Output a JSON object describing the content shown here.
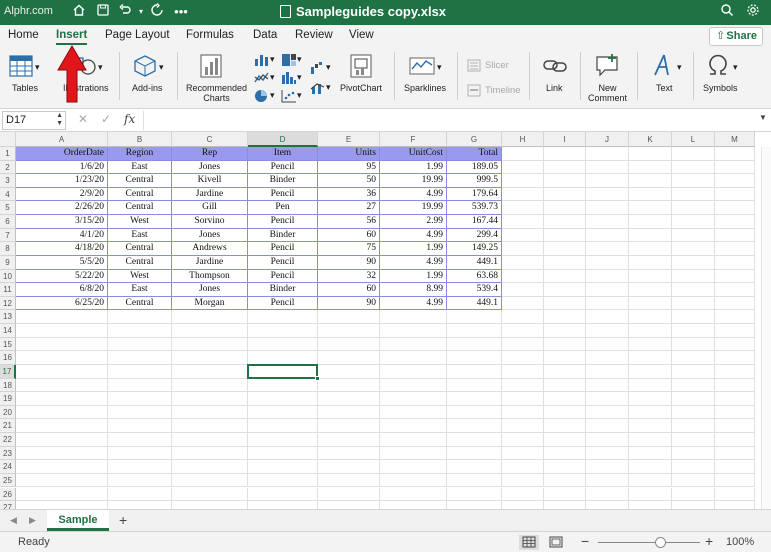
{
  "watermark": "Alphr.com",
  "window": {
    "title": "Sampleguides copy.xlsx"
  },
  "tabs": [
    {
      "label": "Home",
      "active": false
    },
    {
      "label": "Insert",
      "active": true
    },
    {
      "label": "Page Layout",
      "active": false
    },
    {
      "label": "Formulas",
      "active": false
    },
    {
      "label": "Data",
      "active": false
    },
    {
      "label": "Review",
      "active": false
    },
    {
      "label": "View",
      "active": false
    }
  ],
  "share_label": "Share",
  "ribbon": {
    "tables": "Tables",
    "illustrations": "Illustrations",
    "addins": "Add-ins",
    "recommended_charts_1": "Recommended",
    "recommended_charts_2": "Charts",
    "pivotchart": "PivotChart",
    "sparklines": "Sparklines",
    "slicer": "Slicer",
    "timeline": "Timeline",
    "link": "Link",
    "new_comment_1": "New",
    "new_comment_2": "Comment",
    "text": "Text",
    "symbols": "Symbols"
  },
  "formula_bar": {
    "name_box": "D17",
    "fx": "fx",
    "value": ""
  },
  "columns": [
    "A",
    "B",
    "C",
    "D",
    "E",
    "F",
    "G",
    "H",
    "I",
    "J",
    "K",
    "L",
    "M"
  ],
  "selected_cell": {
    "column": "D",
    "row": 17
  },
  "table": {
    "headers": [
      "OrderDate",
      "Region",
      "Rep",
      "Item",
      "Units",
      "UnitCost",
      "Total"
    ],
    "rows": [
      [
        "1/6/20",
        "East",
        "Jones",
        "Pencil",
        "95",
        "1.99",
        "189.05"
      ],
      [
        "1/23/20",
        "Central",
        "Kivell",
        "Binder",
        "50",
        "19.99",
        "999.5"
      ],
      [
        "2/9/20",
        "Central",
        "Jardine",
        "Pencil",
        "36",
        "4.99",
        "179.64"
      ],
      [
        "2/26/20",
        "Central",
        "Gill",
        "Pen",
        "27",
        "19.99",
        "539.73"
      ],
      [
        "3/15/20",
        "West",
        "Sorvino",
        "Pencil",
        "56",
        "2.99",
        "167.44"
      ],
      [
        "4/1/20",
        "East",
        "Jones",
        "Binder",
        "60",
        "4.99",
        "299.4"
      ],
      [
        "4/18/20",
        "Central",
        "Andrews",
        "Pencil",
        "75",
        "1.99",
        "149.25"
      ],
      [
        "5/5/20",
        "Central",
        "Jardine",
        "Pencil",
        "90",
        "4.99",
        "449.1"
      ],
      [
        "5/22/20",
        "West",
        "Thompson",
        "Pencil",
        "32",
        "1.99",
        "63.68"
      ],
      [
        "6/8/20",
        "East",
        "Jones",
        "Binder",
        "60",
        "8.99",
        "539.4"
      ],
      [
        "6/25/20",
        "Central",
        "Morgan",
        "Pencil",
        "90",
        "4.99",
        "449.1"
      ]
    ]
  },
  "sheet_tabs": [
    {
      "label": "Sample",
      "active": true
    }
  ],
  "add_sheet": "+",
  "status": {
    "text": "Ready",
    "zoom": "100%",
    "zoom_fraction": 0.62
  },
  "colors": {
    "accent": "#1f7244",
    "table_header": "#9999ee",
    "table_border": "#8b8be0",
    "annotation": "#e0161b"
  }
}
